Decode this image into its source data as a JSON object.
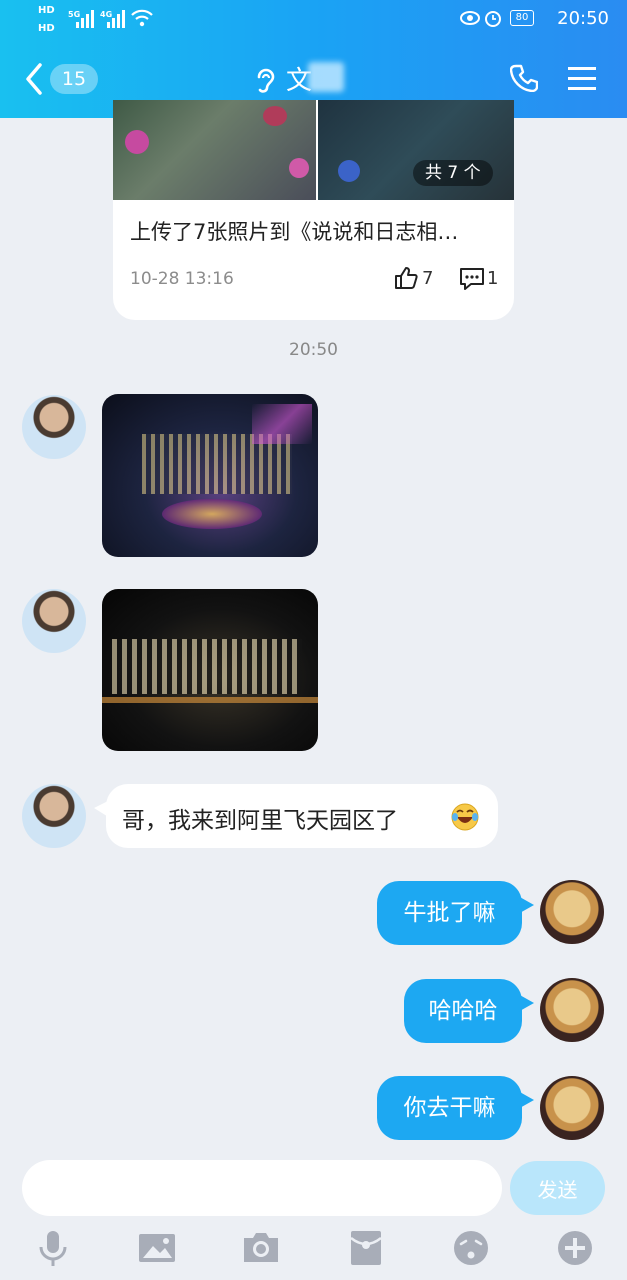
{
  "status_bar": {
    "left_top": "HD",
    "left_bottom": "HD",
    "net1": "5G",
    "net2": "4G",
    "battery": "80",
    "time": "20:50"
  },
  "header": {
    "unread": "15",
    "title": "文"
  },
  "feed_card": {
    "count_label": "共 7 个",
    "title": "上传了7张照片到《说说和日志相…",
    "date": "10-28 13:16",
    "likes": "7",
    "comments": "1"
  },
  "timestamp": "20:50",
  "messages": [
    {
      "side": "left",
      "type": "image",
      "scene": "Alibaba Feitian campus atrium at night with lights"
    },
    {
      "side": "left",
      "type": "image",
      "scene": "Office buildings at night"
    },
    {
      "side": "left",
      "type": "text",
      "text": "哥，我来到阿里飞天园区了"
    },
    {
      "side": "right",
      "type": "text",
      "text": "牛批了嘛"
    },
    {
      "side": "right",
      "type": "text",
      "text": "哈哈哈"
    },
    {
      "side": "right",
      "type": "text",
      "text": "你去干嘛"
    }
  ],
  "input": {
    "placeholder": "",
    "value": "",
    "send_label": "发送"
  },
  "toolbar": [
    "voice-icon",
    "image-icon",
    "camera-icon",
    "red-packet-icon",
    "emoji-icon",
    "plus-icon"
  ],
  "colors": {
    "accent": "#1da8f2",
    "header_start": "#19c0f0",
    "header_end": "#2a8cf2",
    "background": "#eceff4"
  }
}
